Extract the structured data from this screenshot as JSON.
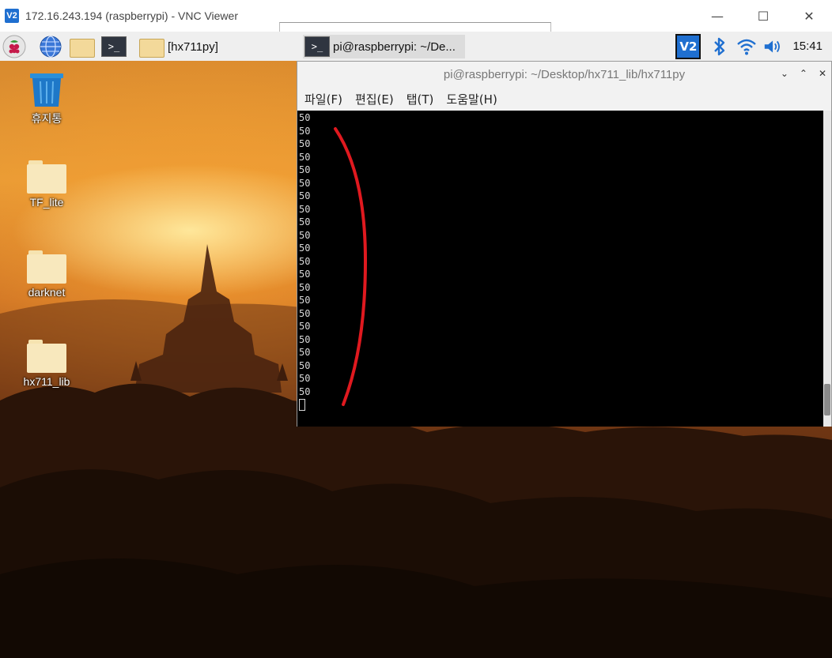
{
  "vnc": {
    "logo_text": "V2",
    "title": "172.16.243.194 (raspberrypi) - VNC Viewer",
    "minimize": "—",
    "maximize": "☐",
    "close": "✕"
  },
  "panel": {
    "terminal_glyph": ">_",
    "tasks": [
      {
        "label": "[hx711py]",
        "kind": "folder",
        "active": false
      },
      {
        "label": "pi@raspberrypi: ~/De...",
        "kind": "terminal",
        "active": true
      }
    ],
    "tray": {
      "vnc_logo": "V2",
      "clock": "15:41"
    }
  },
  "desktop": {
    "icons": [
      {
        "label": "휴지통",
        "type": "trash"
      },
      {
        "label": "TF_lite",
        "type": "folder"
      },
      {
        "label": "darknet",
        "type": "folder"
      },
      {
        "label": "hx711_lib",
        "type": "folder"
      }
    ]
  },
  "terminal": {
    "title": "pi@raspberrypi: ~/Desktop/hx711_lib/hx711py",
    "menu": [
      "파일(F)",
      "편집(E)",
      "탭(T)",
      "도움말(H)"
    ],
    "lines": [
      "50",
      "50",
      "50",
      "50",
      "50",
      "50",
      "50",
      "50",
      "50",
      "50",
      "50",
      "50",
      "50",
      "50",
      "50",
      "50",
      "50",
      "50",
      "50",
      "50",
      "50",
      "50"
    ]
  },
  "colors": {
    "annotation": "#e0191f",
    "vnc_blue": "#1f6fd0"
  }
}
